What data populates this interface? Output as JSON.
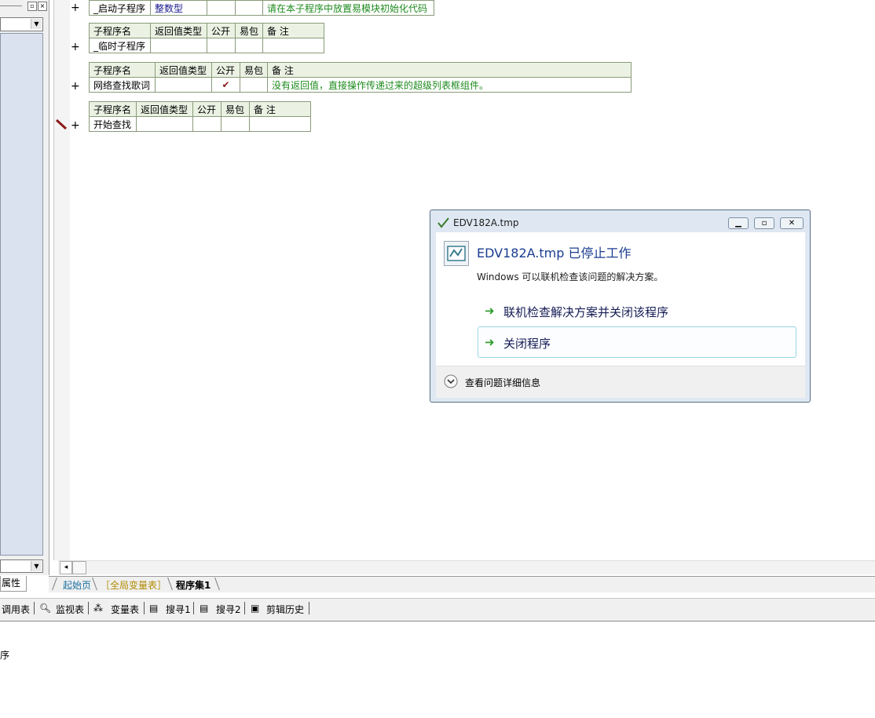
{
  "left_pane": {
    "properties_tab": "属性",
    "status_fragment": "序"
  },
  "editor": {
    "tables": [
      {
        "headers": [
          "子程序名",
          "返回值类型",
          "公开",
          "易包",
          "备 注"
        ],
        "row": {
          "name": "_启动子程序",
          "return_type": "整数型",
          "public": "",
          "pkg": "",
          "note": "请在本子程序中放置易模块初始化代码"
        }
      },
      {
        "headers": [
          "子程序名",
          "返回值类型",
          "公开",
          "易包",
          "备 注"
        ],
        "row": {
          "name": "_临时子程序",
          "return_type": "",
          "public": "",
          "pkg": "",
          "note": ""
        }
      },
      {
        "headers": [
          "子程序名",
          "返回值类型",
          "公开",
          "易包",
          "备 注"
        ],
        "row": {
          "name": "网络查找歌词",
          "return_type": "",
          "public": "✔",
          "pkg": "",
          "note": "没有返回值，直接操作传递过来的超级列表框组件。"
        }
      },
      {
        "headers": [
          "子程序名",
          "返回值类型",
          "公开",
          "易包",
          "备 注"
        ],
        "row": {
          "name": "开始查找",
          "return_type": "",
          "public": "",
          "pkg": "",
          "note": ""
        }
      }
    ],
    "expand_symbol": "+"
  },
  "dialog": {
    "title": "EDV182A.tmp",
    "heading": "EDV182A.tmp 已停止工作",
    "message": "Windows 可以联机检查该问题的解决方案。",
    "option_check_online": "联机检查解决方案并关闭该程序",
    "option_close": "关闭程序",
    "details": "查看问题详细信息",
    "arrow_glyph": "➜"
  },
  "tabs": {
    "start_page": "起始页",
    "globals": "［全局变量表］",
    "program_set": "程序集1"
  },
  "toolbar": {
    "call_table": "调用表",
    "watch_table": "监视表",
    "var_table": "变量表",
    "search1": "搜寻1",
    "search2": "搜寻2",
    "clip_history": "剪辑历史"
  },
  "colors": {
    "accent_green": "#1d8a1d",
    "navy_text": "#1a1a8c",
    "dialog_heading": "#1a3d8f"
  }
}
